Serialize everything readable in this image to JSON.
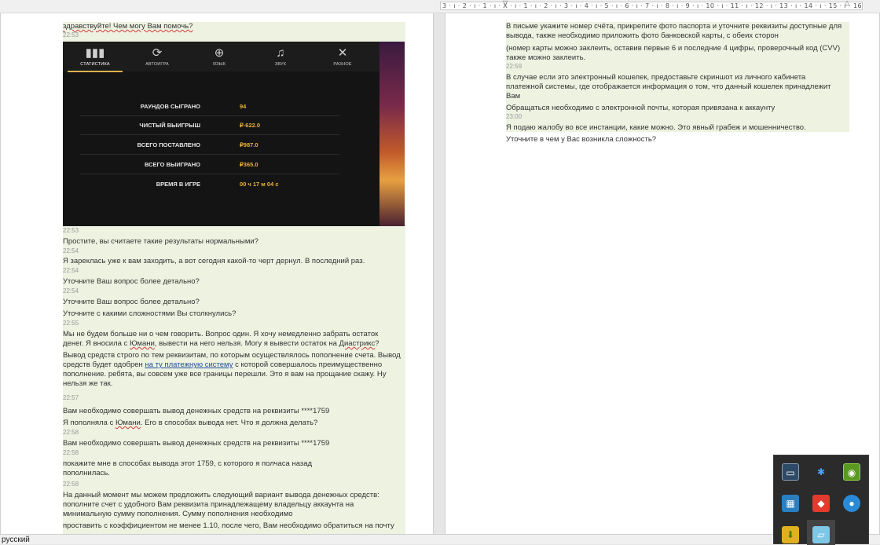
{
  "ruler": {
    "ticks": "3 · ı · 2 · ı · 1 · ı · X · ı · 1 · ı · 2 · ı · 3 · ı · 4 · ı · 5 · ı · 6 · ı · 7 · ı · 8 · ı · 9 · ı · 10 · ı · 11 · ı · 12 · ı · 13 · ı · 14 · ı · 15 · ı · 16 · ı · 17 · ı"
  },
  "left_chat": [
    {
      "text": "здравствуйте! Чем могу Вам помочь?",
      "time": "22:53"
    },
    {
      "text": "",
      "time": "22:53"
    },
    {
      "text": "Простите, вы считаете такие результаты нормальными?",
      "time": "22:54"
    },
    {
      "text": "Я зареклась уже к вам заходить, а вот сегодня какой-то черт дернул. В последний раз.",
      "time": "22:54"
    },
    {
      "text": "Уточните Ваш вопрос более детально?",
      "time": "22:54"
    },
    {
      "text": "Уточните Ваш вопрос более детально?",
      "time": ""
    },
    {
      "text": "Уточните с какими сложностями Вы столкнулись?",
      "time": "22:55"
    },
    {
      "text_parts": [
        "Мы не будем больше ни о чем говорить. Вопрос один. Я хочу немедленно забрать остаток денег. Я вносила с ",
        "Юмани",
        ", вывести на него нельзя. Могу я вывести остаток на ",
        "Диастрикс",
        "?"
      ]
    },
    {
      "text_parts": [
        "Вывод средств строго по тем реквизитам, по которым осуществлялось пополнение счета. Вывод средств будет одобрен ",
        "на ту платежную систему",
        " с которой совершалось преимущественно пополнение. ребята, вы совсем уже все границы перешли. Это я вам на прощание скажу. Ну нельзя же так."
      ],
      "time": "22:57"
    },
    {
      "text": "Вам необходимо совершать вывод денежных средств на реквизиты ****1759",
      "time": ""
    },
    {
      "text_parts": [
        "Я пополняла с ",
        "Юмани",
        ". Его в способах вывода нет. Что я должна делать?"
      ],
      "time": "22:58"
    },
    {
      "text": "Вам необходимо совершать вывод денежных средств на реквизиты ****1759",
      "time": "22:58"
    },
    {
      "text": "покажите мне в способах вывода этот 1759, с которого я полчаса назад пополнилась.",
      "time": "22:58"
    },
    {
      "text": "На данный момент мы можем предложить следующий вариант вывода денежных средств: пополните счет с удобного Вам реквизита принадлежащему владельцу аккаунта на минимальную сумму пополнения. Сумму пополнения необходимо",
      "time": ""
    },
    {
      "text": "проставить с коэффициентом не менее 1.10, после чего, Вам необходимо обратиться на почту",
      "time": ""
    }
  ],
  "game": {
    "tabs": [
      {
        "label": "СТАТИСТИКА",
        "icon": "bar-chart-icon",
        "glyph": "📊",
        "active": true
      },
      {
        "label": "АВТОИГРА",
        "icon": "refresh-icon",
        "glyph": "⟳",
        "active": false
      },
      {
        "label": "ЯЗЫК",
        "icon": "globe-icon",
        "glyph": "🌐",
        "active": false
      },
      {
        "label": "ЗВУК",
        "icon": "music-note-icon",
        "glyph": "♫",
        "active": false
      },
      {
        "label": "РАЗНОЕ",
        "icon": "tools-icon",
        "glyph": "✂",
        "active": false
      }
    ],
    "stats": [
      {
        "label": "РАУНДОВ СЫГРАНО",
        "value": "94"
      },
      {
        "label": "ЧИСТЫЙ ВЫИГРЫШ",
        "value": "₽-622.0"
      },
      {
        "label": "ВСЕГО ПОСТАВЛЕНО",
        "value": "₽987.0"
      },
      {
        "label": "ВСЕГО ВЫИГРАНО",
        "value": "₽365.0"
      },
      {
        "label": "ВРЕМЯ В ИГРЕ",
        "value": "00 ч 17 м 04 с"
      }
    ]
  },
  "right_chat": [
    {
      "text": "В письме укажите номер счёта, прикрепите фото паспорта и уточните реквизиты доступные для вывода, также необходимо приложить фото банковской карты, с обеих сторон",
      "time": ""
    },
    {
      "text": "(номер карты можно заклеить, оставив первые 6 и последние 4 цифры, проверочный код (CVV) также можно заклеить.",
      "time": "22:59"
    },
    {
      "text": "В случае если это электронный кошелек, предоставьте скриншот из личного кабинета платежной системы, где отображается информация о том, что данный кошелек принадлежит Вам",
      "time": ""
    },
    {
      "text": "Обращаться необходимо с электронной почты, которая привязана к аккаунту",
      "time": "23:00"
    },
    {
      "text": "Я подаю жалобу во все инстанции, какие можно. Это явный грабеж и мошенничество.",
      "time": ""
    },
    {
      "text": "Уточните в чем у Вас возникла сложность?",
      "time": ""
    }
  ],
  "status_bar": {
    "language": "русский"
  },
  "tray": {
    "icons": [
      {
        "name": "display-icon",
        "glyph": "▭",
        "color": "#3a5f8a"
      },
      {
        "name": "bluetooth-icon",
        "glyph": "✱",
        "color": "#1b6fd6"
      },
      {
        "name": "nvidia-icon",
        "glyph": "◉",
        "color": "#5a9a20"
      },
      {
        "name": "network-monitor-icon",
        "glyph": "▦",
        "color": "#2a7fc0"
      },
      {
        "name": "anydesk-icon",
        "glyph": "◆",
        "color": "#e23b2e"
      },
      {
        "name": "browser-update-icon",
        "glyph": "●",
        "color": "#2a8ad6"
      },
      {
        "name": "download-icon",
        "glyph": "⬇",
        "color": "#e0b020"
      },
      {
        "name": "app-icon",
        "glyph": "▱",
        "color": "#7fc7e6"
      }
    ]
  }
}
